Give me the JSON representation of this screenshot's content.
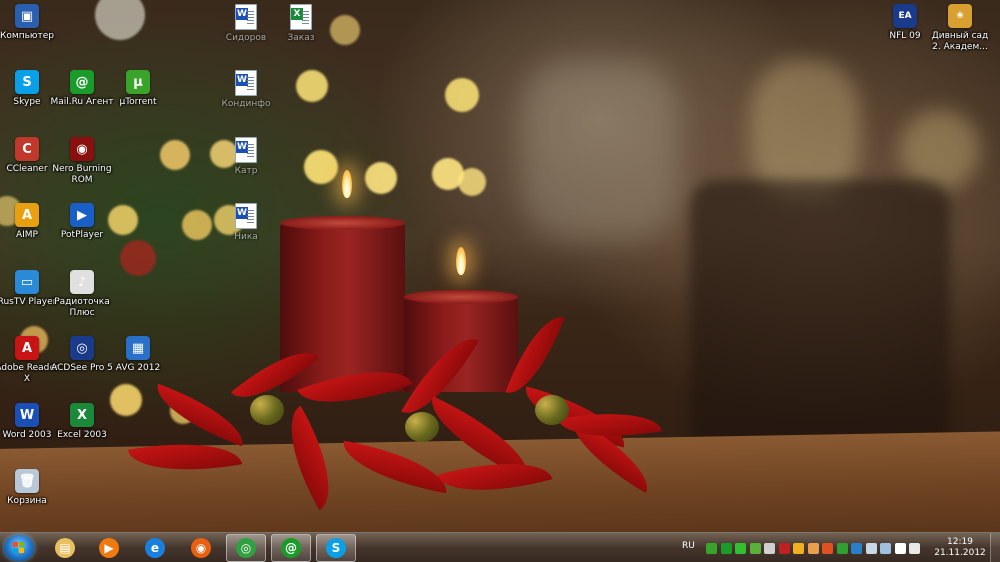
{
  "desktop": {
    "icons_left": [
      {
        "label": "Компьютер",
        "icon": "computer-icon",
        "color": "#2a5fb0",
        "glyph": "▣"
      },
      {
        "label": "Skype",
        "icon": "skype-icon",
        "color": "#0aa0e8",
        "glyph": "S"
      },
      {
        "label": "Mail.Ru Агент",
        "icon": "mailru-agent-icon",
        "color": "#1a9c2a",
        "glyph": "@"
      },
      {
        "label": "µTorrent",
        "icon": "utorrent-icon",
        "color": "#3aa32a",
        "glyph": "µ"
      },
      {
        "label": "CCleaner",
        "icon": "ccleaner-icon",
        "color": "#c0392b",
        "glyph": "C"
      },
      {
        "label": "Nero Burning ROM",
        "icon": "nero-icon",
        "color": "#8a1010",
        "glyph": "◉"
      },
      {
        "label": "AIMP",
        "icon": "aimp-icon",
        "color": "#e8a010",
        "glyph": "A"
      },
      {
        "label": "PotPlayer",
        "icon": "potplayer-icon",
        "color": "#1a5ec8",
        "glyph": "▶"
      },
      {
        "label": "RusTV Player",
        "icon": "rustv-icon",
        "color": "#2a8ad8",
        "glyph": "▭"
      },
      {
        "label": "Радиоточка Плюс",
        "icon": "radio-icon",
        "color": "#e0e0e0",
        "glyph": "♪"
      },
      {
        "label": "Adobe Reader X",
        "icon": "adobe-reader-icon",
        "color": "#c81414",
        "glyph": "A"
      },
      {
        "label": "ACDSee Pro 5",
        "icon": "acdsee-icon",
        "color": "#1a3a8a",
        "glyph": "◎"
      },
      {
        "label": "AVG 2012",
        "icon": "avg-icon",
        "color": "#2a70c8",
        "glyph": "▦"
      },
      {
        "label": "Word 2003",
        "icon": "word-icon",
        "color": "#1a4fb5",
        "glyph": "W"
      },
      {
        "label": "Excel 2003",
        "icon": "excel-icon",
        "color": "#1a8a3a",
        "glyph": "X"
      },
      {
        "label": "Корзина",
        "icon": "recycle-bin-icon",
        "color": "#b8c8d8",
        "glyph": "🗑"
      }
    ],
    "docs_middle": [
      {
        "label": "Сидоров",
        "icon": "word-doc-icon",
        "badge": "W",
        "color": "#1a4fb5"
      },
      {
        "label": "Заказ",
        "icon": "excel-doc-icon",
        "badge": "X",
        "color": "#1a8a3a"
      },
      {
        "label": "Кондинфо",
        "icon": "word-doc-icon",
        "badge": "W",
        "color": "#1a4fb5"
      },
      {
        "label": "Катр",
        "icon": "word-doc-icon",
        "badge": "W",
        "color": "#1a4fb5"
      },
      {
        "label": "Ника",
        "icon": "word-doc-icon",
        "badge": "W",
        "color": "#1a4fb5"
      }
    ],
    "icons_right": [
      {
        "label": "NFL 09",
        "icon": "nfl-icon",
        "color": "#1a3a8a",
        "glyph": "EA"
      },
      {
        "label": "Дивный сад 2. Академ...",
        "icon": "garden-game-icon",
        "color": "#d8a030",
        "glyph": "❀"
      }
    ]
  },
  "taskbar": {
    "start_label": "Start",
    "pinned": [
      {
        "name": "explorer-icon",
        "color": "#e8c060",
        "glyph": "▤"
      },
      {
        "name": "media-player-icon",
        "color": "#f07a10",
        "glyph": "▶"
      },
      {
        "name": "internet-explorer-icon",
        "color": "#1a80e0",
        "glyph": "e"
      },
      {
        "name": "firefox-icon",
        "color": "#e86010",
        "glyph": "◉"
      },
      {
        "name": "chrome-icon",
        "color": "#30a040",
        "glyph": "◎",
        "active": true
      },
      {
        "name": "mailru-agent-icon",
        "color": "#1a9c2a",
        "glyph": "@",
        "active": true
      },
      {
        "name": "skype-icon",
        "color": "#0aa0e8",
        "glyph": "S",
        "active": true
      }
    ],
    "tray": {
      "language": "RU",
      "icons": [
        {
          "name": "utorrent-tray-icon",
          "color": "#3aa32a"
        },
        {
          "name": "mailru-tray-icon",
          "color": "#1a9c2a"
        },
        {
          "name": "skype-tray-icon",
          "color": "#30c030"
        },
        {
          "name": "update-tray-icon",
          "color": "#5ab03a"
        },
        {
          "name": "flag-tray-icon",
          "color": "#d0d0d0"
        },
        {
          "name": "network-tray-icon",
          "color": "#c02020"
        },
        {
          "name": "avg-tray-icon",
          "color": "#f0b020"
        },
        {
          "name": "tool-tray-icon",
          "color": "#e8a050"
        },
        {
          "name": "volume-alert-tray-icon",
          "color": "#e05020"
        },
        {
          "name": "security-tray-icon",
          "color": "#30a030"
        },
        {
          "name": "device-tray-icon",
          "color": "#2a80c8"
        },
        {
          "name": "usb-tray-icon",
          "color": "#c8d8e8"
        },
        {
          "name": "display-tray-icon",
          "color": "#a0c0e0"
        },
        {
          "name": "signal-tray-icon",
          "color": "#ffffff"
        },
        {
          "name": "speaker-tray-icon",
          "color": "#e8e8e8"
        }
      ],
      "clock_time": "12:19",
      "clock_date": "21.11.2012"
    }
  }
}
